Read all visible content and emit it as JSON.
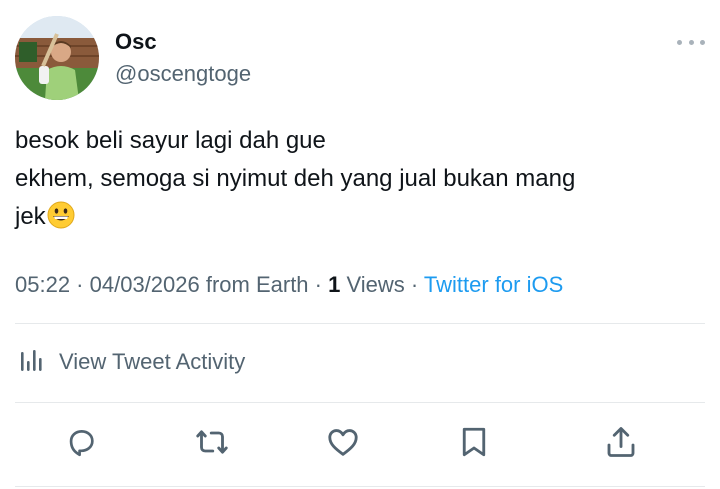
{
  "author": {
    "display_name": "Osc",
    "handle": "@oscengtoge",
    "avatar_icon": "profile-photo"
  },
  "tweet": {
    "lines": [
      "besok beli sayur lagi dah gue",
      "ekhem, semoga si nyimut deh yang jual bukan mang",
      "jek"
    ],
    "emoji": "grinning-face-emoji"
  },
  "meta": {
    "time": "05:22",
    "sep1": " · ",
    "date": "04/03/2026",
    "location": " from Earth",
    "sep2": " · ",
    "views_count": "1",
    "views_label": " Views",
    "sep3": " · ",
    "source": "Twitter for iOS"
  },
  "activity": {
    "label": "View Tweet Activity",
    "icon": "analytics-bars-icon"
  },
  "actions": {
    "reply_icon": "reply-icon",
    "retweet_icon": "retweet-icon",
    "like_icon": "heart-icon",
    "bookmark_icon": "bookmark-icon",
    "share_icon": "share-icon"
  },
  "colors": {
    "text_primary": "#0f1419",
    "text_secondary": "#536471",
    "link": "#1d9bf0",
    "divider": "#e6e9eb"
  }
}
